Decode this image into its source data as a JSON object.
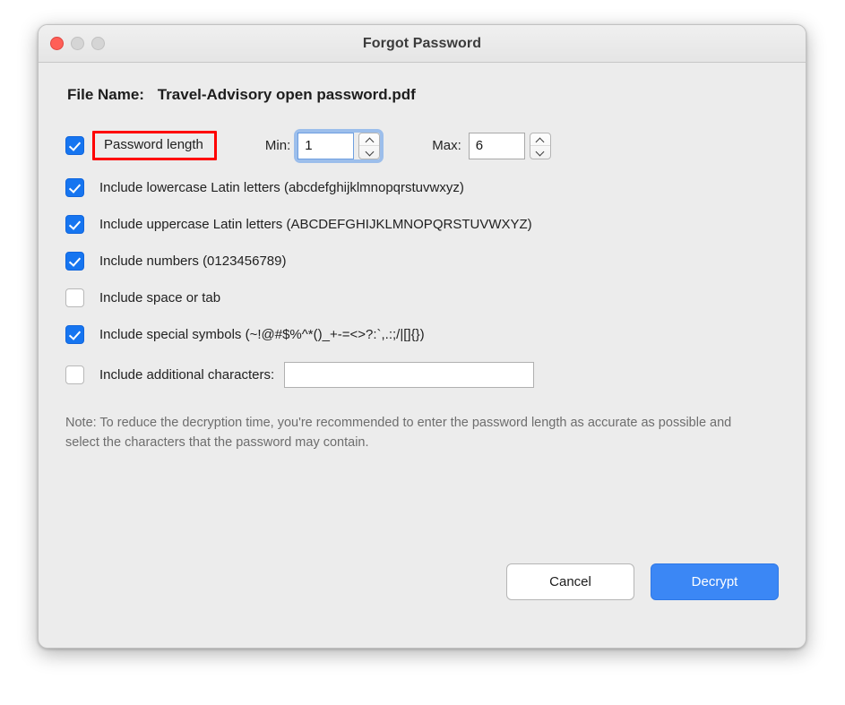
{
  "window": {
    "title": "Forgot Password",
    "traffic_lights": [
      "close-red",
      "minimize-grey",
      "zoom-grey"
    ]
  },
  "file": {
    "label": "File Name:",
    "name": "Travel-Advisory open password.pdf"
  },
  "password_length": {
    "label": "Password length",
    "checked": true,
    "highlighted": true,
    "highlight_color": "#ff0000",
    "min": {
      "label": "Min:",
      "value": "1",
      "focused": true
    },
    "max": {
      "label": "Max:",
      "value": "6",
      "focused": false
    }
  },
  "options": [
    {
      "label": "Include lowercase Latin letters (abcdefghijklmnopqrstuvwxyz)",
      "checked": true
    },
    {
      "label": "Include uppercase Latin letters (ABCDEFGHIJKLMNOPQRSTUVWXYZ)",
      "checked": true
    },
    {
      "label": "Include numbers (0123456789)",
      "checked": true
    },
    {
      "label": "Include space or tab",
      "checked": false
    },
    {
      "label": "Include special symbols (~!@#$%^*()_+-=<>?:`,.:;/|[]{})",
      "checked": true
    }
  ],
  "additional": {
    "label": "Include additional characters:",
    "checked": false,
    "value": "",
    "placeholder": ""
  },
  "note": "Note: To reduce the decryption time, you're recommended to enter the password length as accurate as possible and select the characters that the password may contain.",
  "buttons": {
    "cancel": "Cancel",
    "decrypt": "Decrypt"
  },
  "colors": {
    "accent": "#1675f0",
    "primary_button": "#3b87f5",
    "highlight": "#ff0000",
    "window_bg": "#ececec"
  }
}
